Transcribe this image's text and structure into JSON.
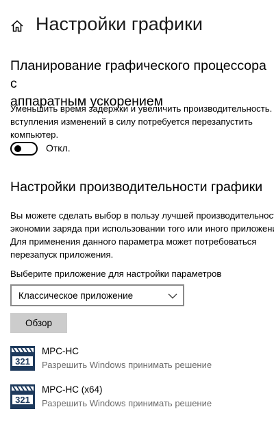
{
  "header": {
    "title": "Настройки графики",
    "home_icon": "home-icon"
  },
  "hags": {
    "title_line1": "Планирование графического процессора с",
    "title_line2": "аппаратным ускорением",
    "desc_line1": "Уменьшить время задержки и увеличить производительность. Для",
    "desc_line2": "вступления изменений в силу потребуется перезапустить",
    "desc_line3": "компьютер.",
    "toggle_state": "off",
    "toggle_label": "Откл."
  },
  "perf": {
    "title": "Настройки производительности графики",
    "desc_line1": "Вы можете сделать выбор в пользу лучшей производительности",
    "desc_line2": "экономии заряда при использовании того или иного приложения",
    "desc_line3": "Для применения данного параметра может потребоваться",
    "desc_line4": "перезапуск приложения.",
    "select_label": "Выберите приложение для настройки параметров",
    "select_value": "Классическое приложение",
    "browse_label": "Обзор"
  },
  "apps": [
    {
      "name": "MPC-HC",
      "subtitle": "Разрешить Windows принимать решение",
      "icon": "mpc-hc-icon",
      "icon_text": "321"
    },
    {
      "name": "MPC-HC (x64)",
      "subtitle": "Разрешить Windows принимать решение",
      "icon": "mpc-hc-icon",
      "icon_text": "321"
    }
  ],
  "colors": {
    "text": "#000000",
    "secondary_text": "#6b6b6b",
    "button_bg": "#cccccc",
    "select_border": "#8a8a8a",
    "icon_bg": "#1e3a5c",
    "icon_text_bg": "#ffffff"
  }
}
